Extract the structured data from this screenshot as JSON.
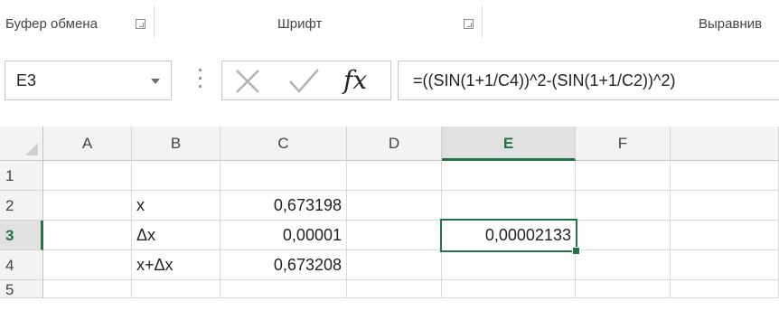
{
  "ribbon": {
    "groups": [
      {
        "label": "Буфер обмена",
        "icon": "dialog-launcher-icon"
      },
      {
        "label": "Шрифт",
        "icon": "dialog-launcher-icon"
      },
      {
        "label": "Выравнив"
      }
    ]
  },
  "formula_bar": {
    "name_box": "E3",
    "fx_label": "fx",
    "formula": "=((SIN(1+1/C4))^2-(SIN(1+1/C2))^2)"
  },
  "sheet": {
    "columns": [
      "A",
      "B",
      "C",
      "D",
      "E",
      "F"
    ],
    "active_column": "E",
    "rows": [
      "1",
      "2",
      "3",
      "4",
      "5"
    ],
    "active_row": "3",
    "cells": {
      "B2": "x",
      "C2": "0,673198",
      "B3": "Δx",
      "C3": "0,00001",
      "E3": "0,00002133",
      "B4": "x+Δx",
      "C4": "0,673208"
    },
    "accent_color": "#217346"
  }
}
